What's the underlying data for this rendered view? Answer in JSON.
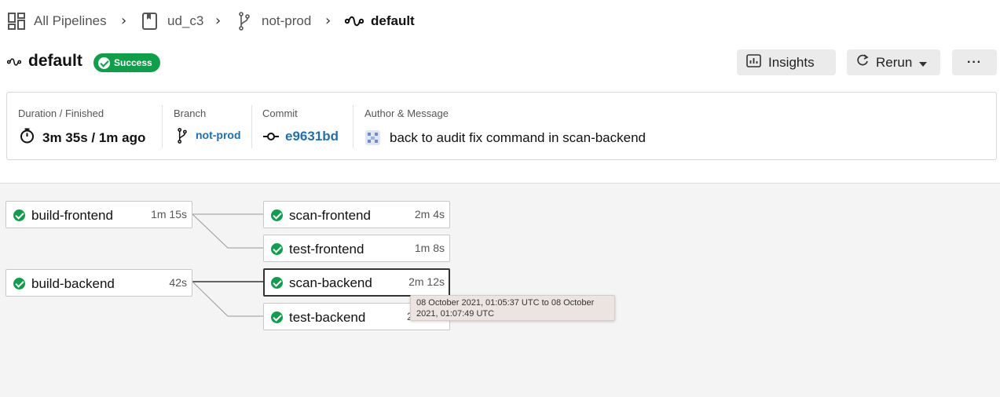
{
  "breadcrumb": {
    "all_pipelines": "All Pipelines",
    "project": "ud_c3",
    "branch": "not-prod",
    "workflow": "default"
  },
  "header": {
    "title": "default",
    "status": "Success",
    "status_color": "#0e9f4a",
    "insights_label": "Insights",
    "rerun_label": "Rerun",
    "more_label": "···"
  },
  "summary": {
    "duration_label": "Duration / Finished",
    "duration_value": "3m 35s / 1m ago",
    "branch_label": "Branch",
    "branch_value": "not-prod",
    "commit_label": "Commit",
    "commit_value": "e9631bd",
    "author_label": "Author & Message",
    "message": "back to audit fix command in scan-backend"
  },
  "jobs": [
    {
      "name": "build-frontend",
      "duration": "1m 15s",
      "status": "success"
    },
    {
      "name": "scan-frontend",
      "duration": "2m 4s",
      "status": "success"
    },
    {
      "name": "test-frontend",
      "duration": "1m 8s",
      "status": "success"
    },
    {
      "name": "build-backend",
      "duration": "42s",
      "status": "success"
    },
    {
      "name": "scan-backend",
      "duration": "2m 12s",
      "status": "success"
    },
    {
      "name": "test-backend",
      "duration": "2",
      "status": "success"
    }
  ],
  "tooltip": {
    "text": "08 October 2021, 01:05:37 UTC to 08 October 2021, 01:07:49 UTC"
  },
  "colors": {
    "success": "#0e9f4a",
    "link": "#1d6fb8"
  }
}
